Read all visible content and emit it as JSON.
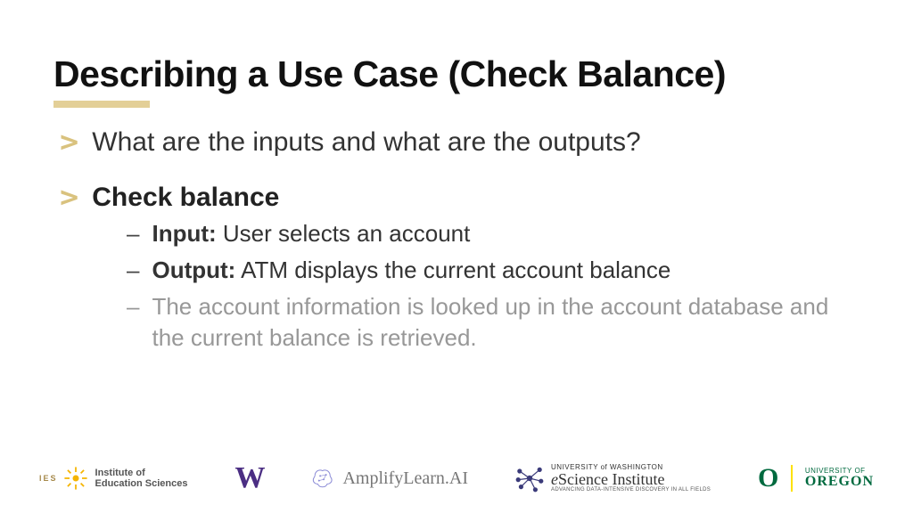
{
  "title": "Describing a Use Case (Check Balance)",
  "bullets": [
    {
      "text": "What are the inputs and what are the outputs?",
      "bold": false
    },
    {
      "text": "Check balance",
      "bold": true
    }
  ],
  "sub": [
    {
      "label": "Input:",
      "text": " User selects an account",
      "muted": false
    },
    {
      "label": "Output:",
      "text": " ATM displays the current account balance",
      "muted": false
    },
    {
      "label": "",
      "text": "The account information is looked up in the account database and the current balance is retrieved.",
      "muted": true
    }
  ],
  "logos": {
    "ies_mark": "IES",
    "ies_label1": "Institute of",
    "ies_label2": "Education Sciences",
    "w": "W",
    "amp": "AmplifyLearn.AI",
    "esci_top": "UNIVERSITY of WASHINGTON",
    "esci_main_e": "e",
    "esci_main_rest": "Science Institute",
    "esci_sub": "ADVANCING DATA-INTENSIVE DISCOVERY IN ALL FIELDS",
    "uo_o": "O",
    "uo_top": "UNIVERSITY OF",
    "uo_main": "OREGON"
  }
}
